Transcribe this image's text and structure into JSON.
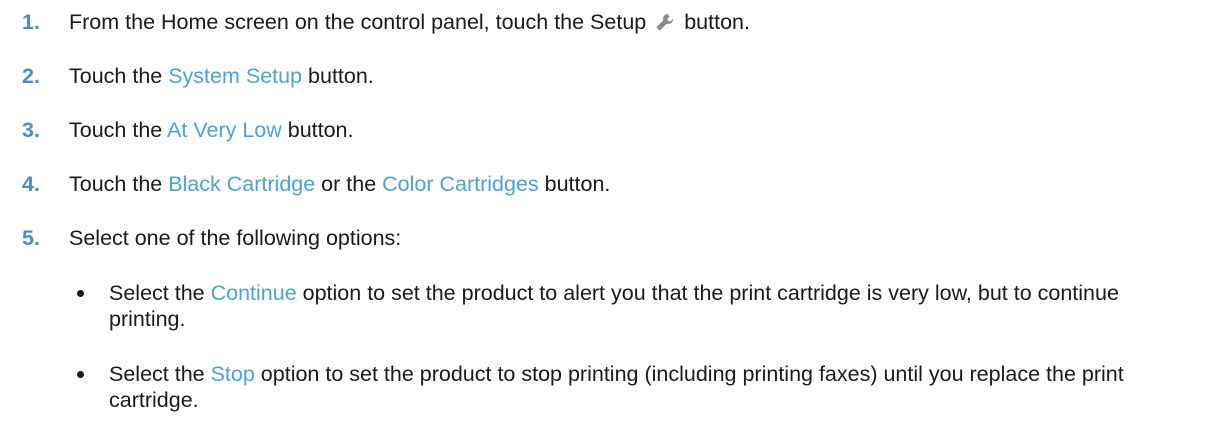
{
  "steps": [
    {
      "number": "1.",
      "before": "From the Home screen on the control panel, touch the Setup ",
      "icon": "wrench-icon",
      "after": " button."
    },
    {
      "number": "2.",
      "before": "Touch the ",
      "keyword": "System Setup",
      "after": " button."
    },
    {
      "number": "3.",
      "before": "Touch the ",
      "keyword": "At Very Low",
      "after": " button."
    },
    {
      "number": "4.",
      "before": "Touch the ",
      "keyword": "Black Cartridge",
      "middle": " or the ",
      "keyword2": "Color Cartridges",
      "after": " button."
    },
    {
      "number": "5.",
      "text": "Select one of the following options:"
    }
  ],
  "bullets": [
    {
      "before": "Select the ",
      "keyword": "Continue",
      "after": " option to set the product to alert you that the print cartridge is very low, but to continue printing."
    },
    {
      "before": "Select the ",
      "keyword": "Stop",
      "after": " option to set the product to stop printing (including printing faxes) until you replace the print cartridge."
    }
  ],
  "colors": {
    "number": "#4a8fc8",
    "keyword": "#4aa3dc",
    "text": "#1a1a1a"
  }
}
